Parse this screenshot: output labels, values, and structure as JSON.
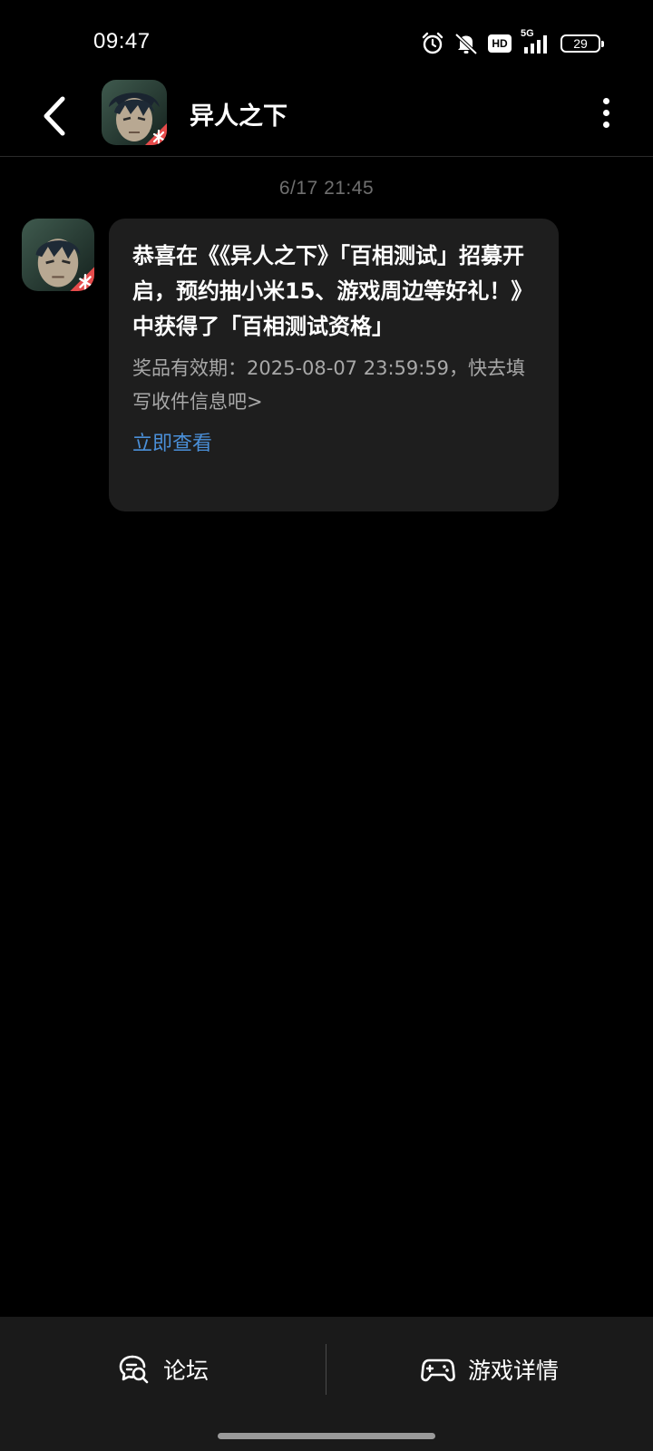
{
  "status_bar": {
    "time": "09:47",
    "network": "5G",
    "hd_label": "HD",
    "battery": "29",
    "icons": [
      "alarm-icon",
      "mute-icon",
      "hd-icon",
      "signal-5g-icon",
      "battery-icon"
    ]
  },
  "header": {
    "title": "异人之下",
    "back_icon": "chevron-left-icon",
    "more_icon": "more-vertical-icon",
    "avatar": "game-avatar"
  },
  "messages": [
    {
      "time": "6/17  21:45",
      "title": "恭喜在《《异人之下》「百相测试」招募开启，预约抽小米15、游戏周边等好礼！》中获得了「百相测试资格」",
      "body": "奖品有效期：2025-08-07 23:59:59，快去填写收件信息吧>",
      "link": "立即查看"
    }
  ],
  "bottom_bar": {
    "tabs": [
      {
        "label": "论坛",
        "icon": "forum-icon"
      },
      {
        "label": "游戏详情",
        "icon": "gamepad-icon"
      }
    ]
  },
  "colors": {
    "background": "#000000",
    "bubble": "#1e1e1e",
    "link": "#4a8fd8",
    "timestamp": "#6f6f6f",
    "body_text": "#a8a8a8",
    "bottom_bar": "#1a1a1a"
  }
}
